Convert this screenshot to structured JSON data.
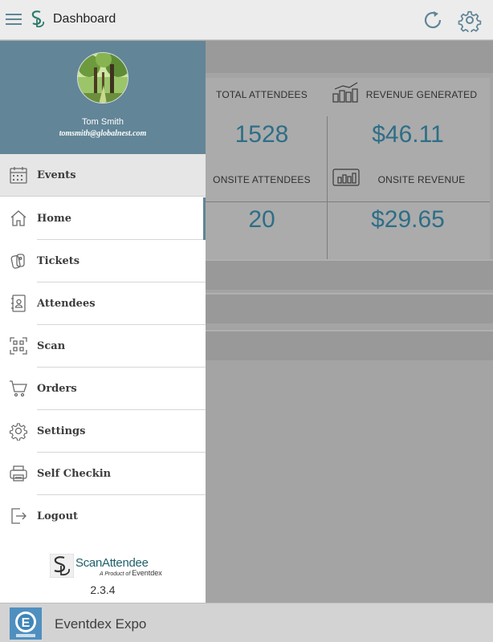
{
  "appbar": {
    "title": "Dashboard"
  },
  "dashboard": {
    "stats": [
      {
        "label": "TOTAL ATTENDEES",
        "value": "1528"
      },
      {
        "label": "REVENUE GENERATED",
        "value": "$46.11"
      },
      {
        "label": "ONSITE ATTENDEES",
        "value": "20"
      },
      {
        "label": "ONSITE REVENUE",
        "value": "$29.65"
      }
    ]
  },
  "drawer": {
    "profile": {
      "name": "Tom Smith",
      "email": "tomsmith@globalnest.com"
    },
    "events_label": "Events",
    "items": [
      {
        "label": "Home",
        "icon": "home-icon",
        "active": true
      },
      {
        "label": "Tickets",
        "icon": "tickets-icon"
      },
      {
        "label": "Attendees",
        "icon": "attendees-icon"
      },
      {
        "label": "Scan",
        "icon": "scan-icon"
      },
      {
        "label": "Orders",
        "icon": "cart-icon"
      },
      {
        "label": "Settings",
        "icon": "gear-icon"
      },
      {
        "label": "Self Checkin",
        "icon": "printer-icon"
      },
      {
        "label": "Logout",
        "icon": "logout-icon"
      }
    ],
    "brand": {
      "name": "ScanAttendee",
      "sub_prefix": "A Product of",
      "sub_company": "Eventdex"
    },
    "version": "2.3.4"
  },
  "bottombar": {
    "event_name": "Eventdex Expo"
  },
  "colors": {
    "drawer_header": "#628597",
    "accent_value": "#2e6e87",
    "active_bar": "#5f8596"
  }
}
